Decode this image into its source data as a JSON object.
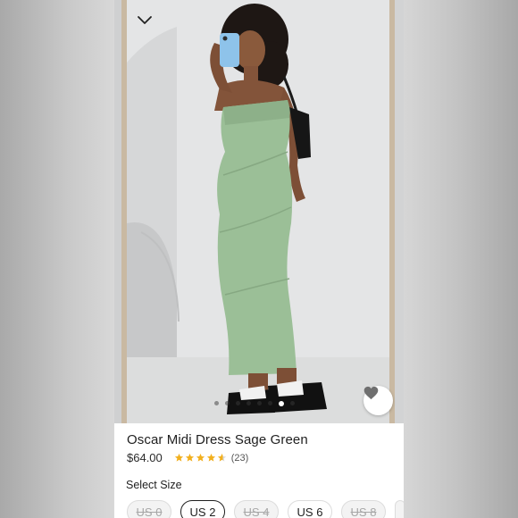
{
  "product": {
    "title": "Oscar Midi Dress Sage Green",
    "price": "$64.00",
    "rating": 4.6,
    "review_count": "(23)",
    "star_color": "#f2b01e"
  },
  "gallery": {
    "slide_count": 8,
    "active_slide": 7
  },
  "size_selector": {
    "label": "Select Size",
    "sizes": [
      {
        "label": "US 0",
        "state": "unavailable"
      },
      {
        "label": "US 2",
        "state": "selected"
      },
      {
        "label": "US 4",
        "state": "unavailable"
      },
      {
        "label": "US 6",
        "state": "available"
      },
      {
        "label": "US 8",
        "state": "unavailable"
      }
    ]
  },
  "icons": {
    "collapse": "chevron-down-icon",
    "favorite": "heart-icon"
  }
}
